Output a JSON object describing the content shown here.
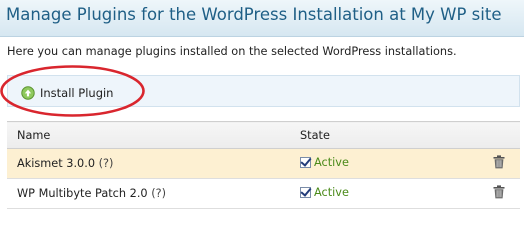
{
  "header": {
    "title": "Manage Plugins for the WordPress Installation at My WP site"
  },
  "description": "Here you can manage plugins installed on the selected WordPress installations.",
  "toolbar": {
    "install_label": "Install Plugin",
    "install_icon": "install-plus-icon"
  },
  "table": {
    "headers": {
      "name": "Name",
      "state": "State"
    },
    "rows": [
      {
        "name": "Akismet 3.0.0",
        "help": "(?)",
        "state": "Active",
        "highlighted": true
      },
      {
        "name": "WP Multibyte Patch 2.0",
        "help": "(?)",
        "state": "Active",
        "highlighted": false
      }
    ]
  },
  "colors": {
    "title": "#1f5f86",
    "active": "#4a8a19",
    "annotation": "#d9262e",
    "row_highlight": "#fdf0d2"
  }
}
